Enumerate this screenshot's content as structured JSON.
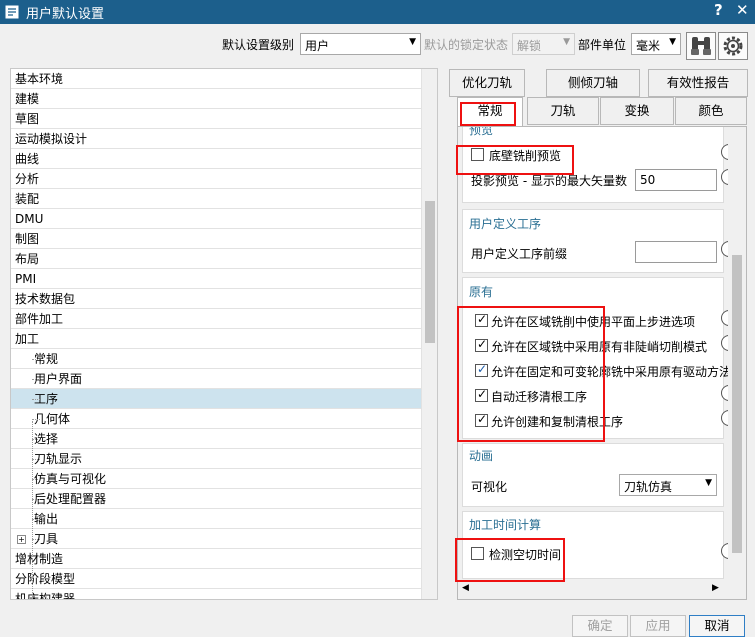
{
  "window": {
    "title": "用户默认设置",
    "help": "?",
    "close": "✕"
  },
  "toolbar": {
    "level_label": "默认设置级别",
    "level_value": "用户",
    "lock_label": "默认的锁定状态",
    "lock_value": "解锁",
    "unit_label": "部件单位",
    "unit_value": "毫米",
    "binocular_icon": "binoculars-icon",
    "settings_icon": "gear-icon"
  },
  "tree": {
    "items": [
      {
        "label": "基本环境"
      },
      {
        "label": "建模"
      },
      {
        "label": "草图"
      },
      {
        "label": "运动模拟设计"
      },
      {
        "label": "曲线"
      },
      {
        "label": "分析"
      },
      {
        "label": "装配"
      },
      {
        "label": "DMU"
      },
      {
        "label": "制图"
      },
      {
        "label": "布局"
      },
      {
        "label": "PMI"
      },
      {
        "label": "技术数据包"
      },
      {
        "label": "部件加工"
      },
      {
        "label": "加工"
      }
    ],
    "children": [
      {
        "label": "常规"
      },
      {
        "label": "用户界面"
      },
      {
        "label": "工序"
      },
      {
        "label": "几何体"
      },
      {
        "label": "选择"
      },
      {
        "label": "刀轨显示"
      },
      {
        "label": "仿真与可视化"
      },
      {
        "label": "后处理配置器"
      },
      {
        "label": "输出"
      },
      {
        "label": "刀具"
      }
    ],
    "tail": [
      {
        "label": "增材制造"
      },
      {
        "label": "分阶段模型"
      },
      {
        "label": "机床构建器"
      }
    ],
    "selected": "工序"
  },
  "tabs_row1": [
    {
      "label": "优化刀轨"
    },
    {
      "label": "侧倾刀轴"
    },
    {
      "label": "有效性报告"
    }
  ],
  "tabs_row2": [
    {
      "label": "常规"
    },
    {
      "label": "刀轨"
    },
    {
      "label": "变换"
    },
    {
      "label": "颜色"
    }
  ],
  "active_tab": "常规",
  "preview": {
    "title": "预览",
    "floor_wall_label": "底壁铣削预览",
    "floor_wall_checked": false,
    "max_vectors_label": "投影预览 - 显示的最大矢量数",
    "max_vectors_value": "50"
  },
  "user_ops": {
    "title": "用户定义工序",
    "prefix_label": "用户定义工序前缀",
    "prefix_value": ""
  },
  "legacy": {
    "title": "原有",
    "options": [
      {
        "label": "允许在区域铣削中使用平面上步进选项",
        "checked": true
      },
      {
        "label": "允许在区域铣中采用原有非陡峭切削模式",
        "checked": true
      },
      {
        "label": "允许在固定和可变轮廓铣中采用原有驱动方法",
        "checked": true
      },
      {
        "label": "自动迁移清根工序",
        "checked": true
      },
      {
        "label": "允许创建和复制清根工序",
        "checked": true
      }
    ]
  },
  "animation": {
    "title": "动画",
    "visualize_label": "可视化",
    "visualize_value": "刀轨仿真"
  },
  "machining_time": {
    "title": "加工时间计算",
    "check_label": "检测空切时间",
    "checked": false
  },
  "buttons": {
    "ok": "确定",
    "apply": "应用",
    "cancel": "取消"
  },
  "colors": {
    "titlebar": "#1c5f8c",
    "highlight": "#ee1111",
    "selected_row": "#cde3ee"
  }
}
